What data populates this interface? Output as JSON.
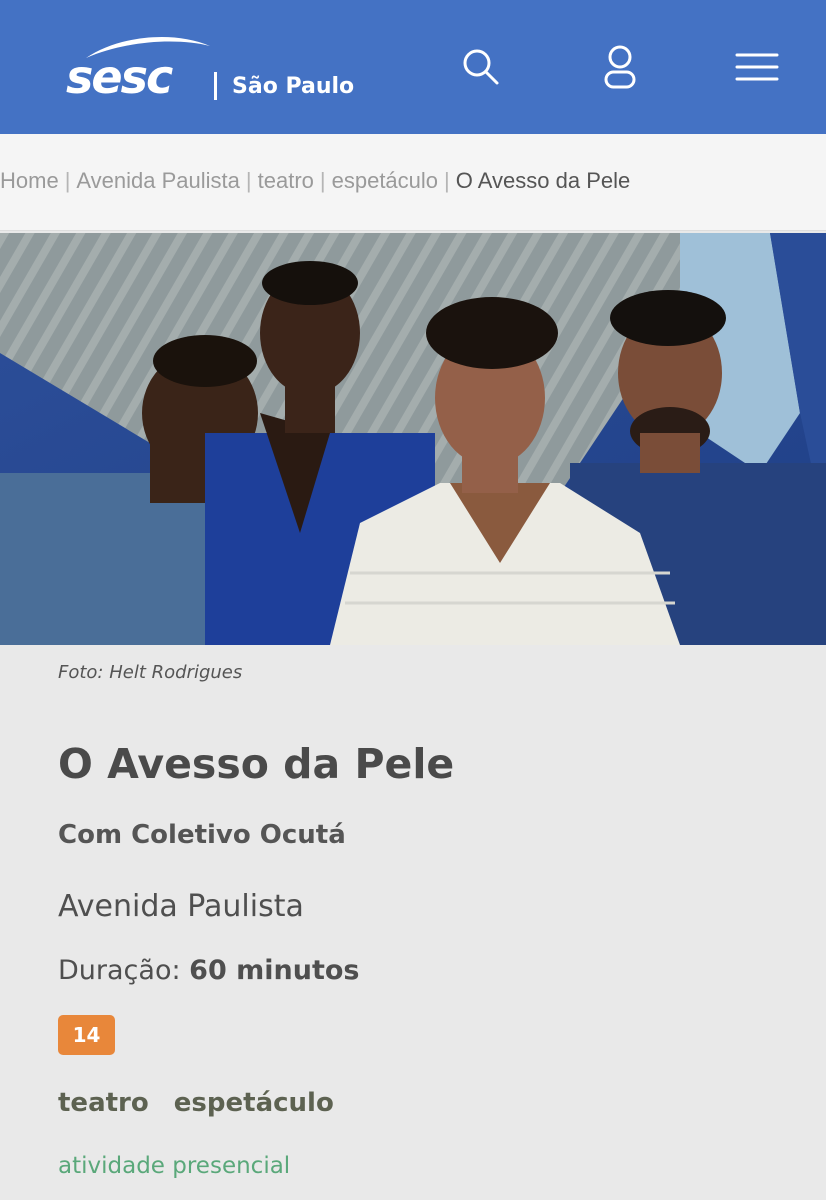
{
  "header": {
    "logo_text": "sesc",
    "city": "São Paulo",
    "icons": [
      "search-icon",
      "user-icon",
      "hamburger-menu-icon"
    ],
    "bg_color": "#4472c4"
  },
  "breadcrumb": {
    "items": [
      "Home",
      "Avenida Paulista",
      "teatro",
      "espetáculo",
      "O Avesso da Pele"
    ],
    "separator": "|"
  },
  "hero": {
    "alt": "Foto: Helt Rodrigues",
    "caption": "Foto: Helt Rodrigues"
  },
  "event": {
    "title": "O Avesso da Pele",
    "subtitle": "Com Coletivo Ocutá",
    "venue": "Avenida Paulista",
    "duration_label": "Duração:",
    "duration_value": "60 minutos",
    "age_rating": "14",
    "age_color": "#e8873a",
    "tags": [
      "teatro",
      "espetáculo"
    ],
    "mode": "atividade presencial",
    "mode_color": "#5aa87a"
  }
}
